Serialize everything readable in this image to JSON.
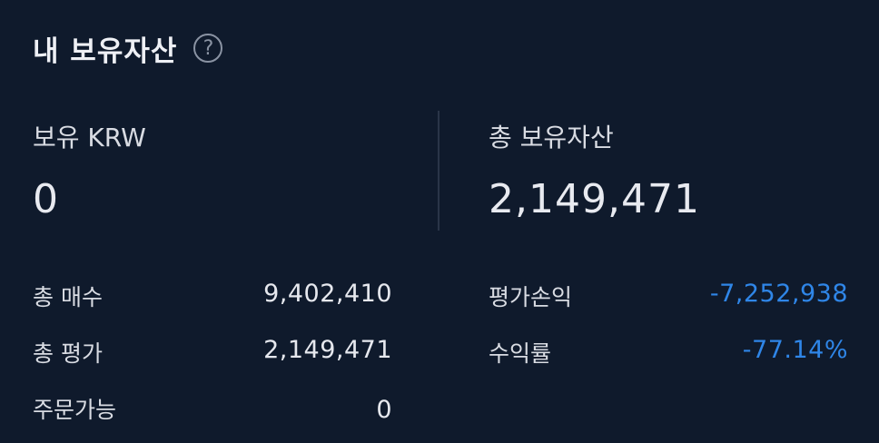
{
  "header": {
    "title": "내 보유자산",
    "help_icon": "question-circle-icon",
    "help_glyph": "?"
  },
  "krw": {
    "label": "보유 KRW",
    "value": "0"
  },
  "total_assets": {
    "label": "총 보유자산",
    "value": "2,149,471"
  },
  "rows_left": [
    {
      "label": "총 매수",
      "value": "9,402,410"
    },
    {
      "label": "총 평가",
      "value": "2,149,471"
    },
    {
      "label": "주문가능",
      "value": "0"
    }
  ],
  "rows_right": [
    {
      "label": "평가손익",
      "value": "-7,252,938"
    },
    {
      "label": "수익률",
      "value": "-77.14%"
    }
  ],
  "colors": {
    "background": "#0f1a2c",
    "negative": "#2f86e8"
  }
}
